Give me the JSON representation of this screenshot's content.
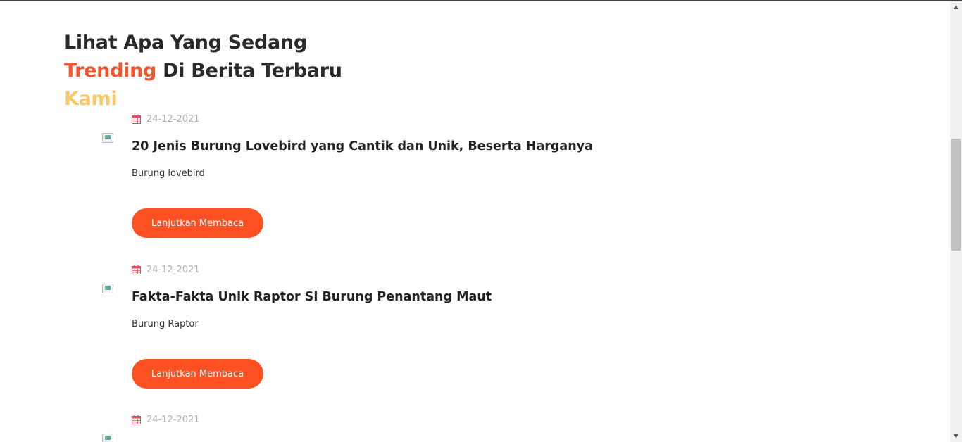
{
  "heading": {
    "line1": "Lihat Apa Yang Sedang",
    "line2_highlight": "Trending",
    "line2_rest": " Di Berita Terbaru",
    "line3": "Kami"
  },
  "colors": {
    "accent": "#fd5124",
    "highlight_orange": "#f3542c",
    "highlight_yellow": "#f9c86a"
  },
  "icons": {
    "date": "calendar-icon",
    "thumbnail": "broken-image-icon"
  },
  "articles": [
    {
      "date": "24-12-2021",
      "title": "20 Jenis Burung Lovebird yang Cantik dan Unik, Beserta Harganya",
      "excerpt": "Burung lovebird",
      "button": "Lanjutkan Membaca"
    },
    {
      "date": "24-12-2021",
      "title": "Fakta-Fakta Unik Raptor Si Burung Penantang Maut",
      "excerpt": "Burung Raptor",
      "button": "Lanjutkan Membaca"
    },
    {
      "date": "24-12-2021"
    }
  ],
  "scrollbar": {
    "up": "▲",
    "down": "▼"
  }
}
